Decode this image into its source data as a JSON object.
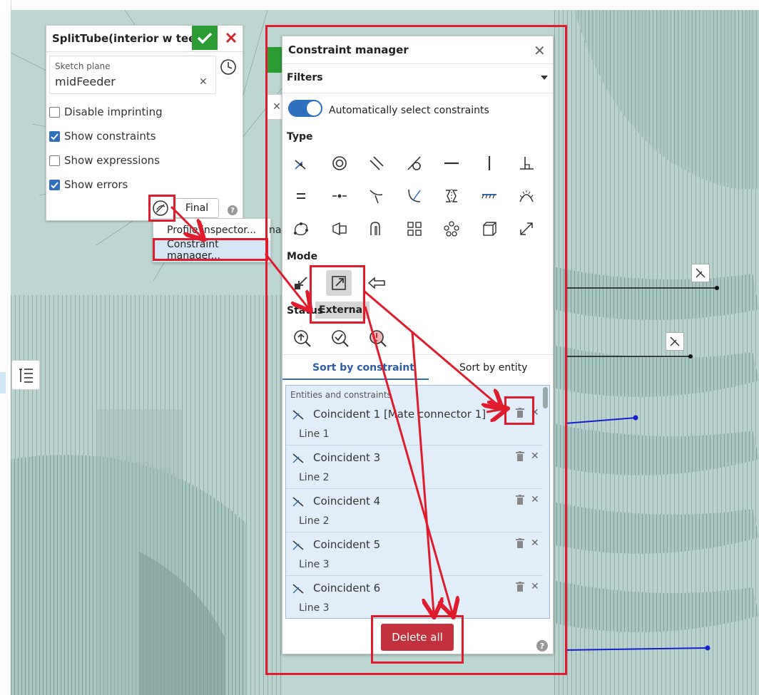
{
  "sketch_panel": {
    "title": "SplitTube(interior w teeth",
    "sketch_plane_label": "Sketch plane",
    "sketch_plane_value": "midFeeder",
    "options": [
      {
        "label": "Disable imprinting",
        "checked": false
      },
      {
        "label": "Show constraints",
        "checked": true
      },
      {
        "label": "Show expressions",
        "checked": false
      },
      {
        "label": "Show errors",
        "checked": true
      }
    ],
    "final_label": "Final",
    "help": "?"
  },
  "menu": {
    "items": [
      "Profile inspector...",
      "Constraint manager..."
    ],
    "partial_text": "na"
  },
  "constraint_manager": {
    "title": "Constraint manager",
    "filters_label": "Filters",
    "auto_select_label": "Automatically select constraints",
    "type_label": "Type",
    "mode_label": "Mode",
    "status_label": "Status",
    "mode_tooltip": "External",
    "tabs": [
      "Sort by constraint",
      "Sort by entity"
    ],
    "list_header": "Entities and constraints",
    "rows": [
      {
        "name": "Coincident 1 [Mate connector 1]",
        "entity": "Line 1"
      },
      {
        "name": "Coincident 3",
        "entity": "Line 2"
      },
      {
        "name": "Coincident 4",
        "entity": "Line 2"
      },
      {
        "name": "Coincident 5",
        "entity": "Line 3"
      },
      {
        "name": "Coincident 6",
        "entity": "Line 3"
      }
    ],
    "delete_all_label": "Delete all",
    "help": "?"
  },
  "colors": {
    "accent": "#2f6fbd",
    "confirm": "#2b9b34",
    "danger": "#c3323c",
    "annotation": "#e01c2c"
  }
}
